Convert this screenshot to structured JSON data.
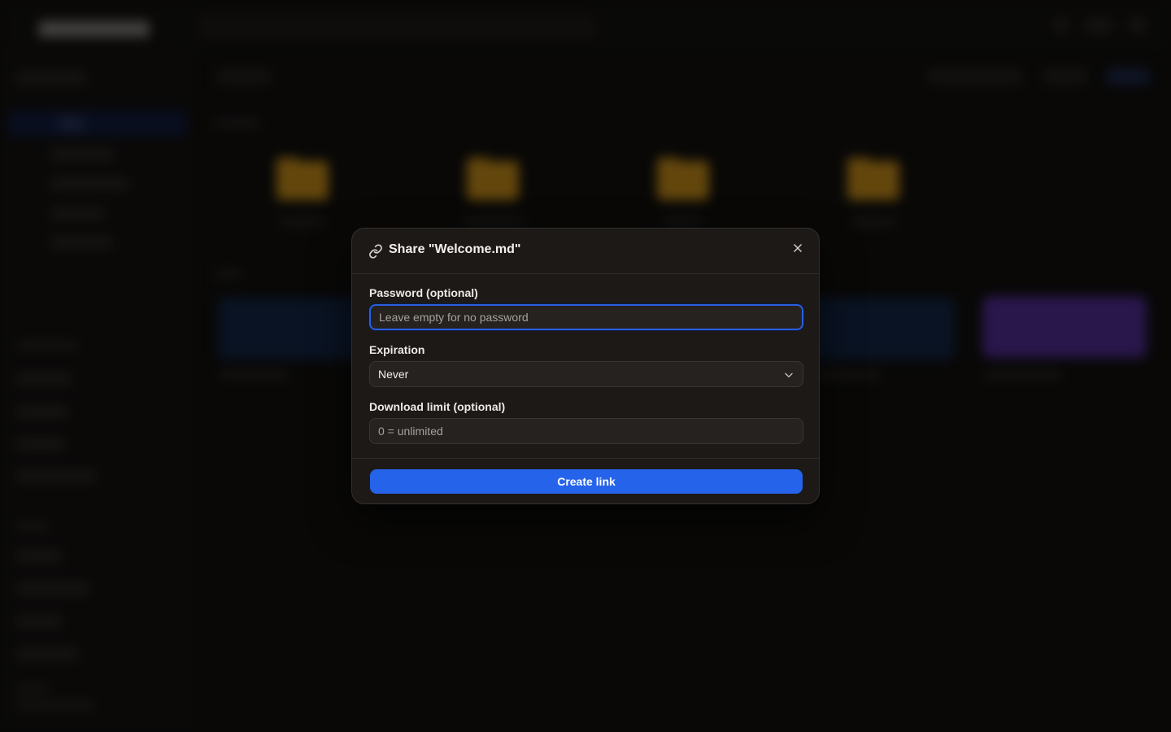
{
  "modal": {
    "title": "Share \"Welcome.md\"",
    "password": {
      "label": "Password (optional)",
      "value": "",
      "placeholder": "Leave empty for no password"
    },
    "expiration": {
      "label": "Expiration",
      "selected": "Never"
    },
    "download_limit": {
      "label": "Download limit (optional)",
      "value": "",
      "placeholder": "0 = unlimited"
    },
    "submit_label": "Create link"
  },
  "colors": {
    "accent": "#2563eb",
    "modal_bg": "#1c1917",
    "folder": "#e8a317",
    "purple_card": "#5b2fb0"
  },
  "icons": {
    "title": "link-icon",
    "close": "close-icon",
    "select": "chevron-down-icon"
  }
}
